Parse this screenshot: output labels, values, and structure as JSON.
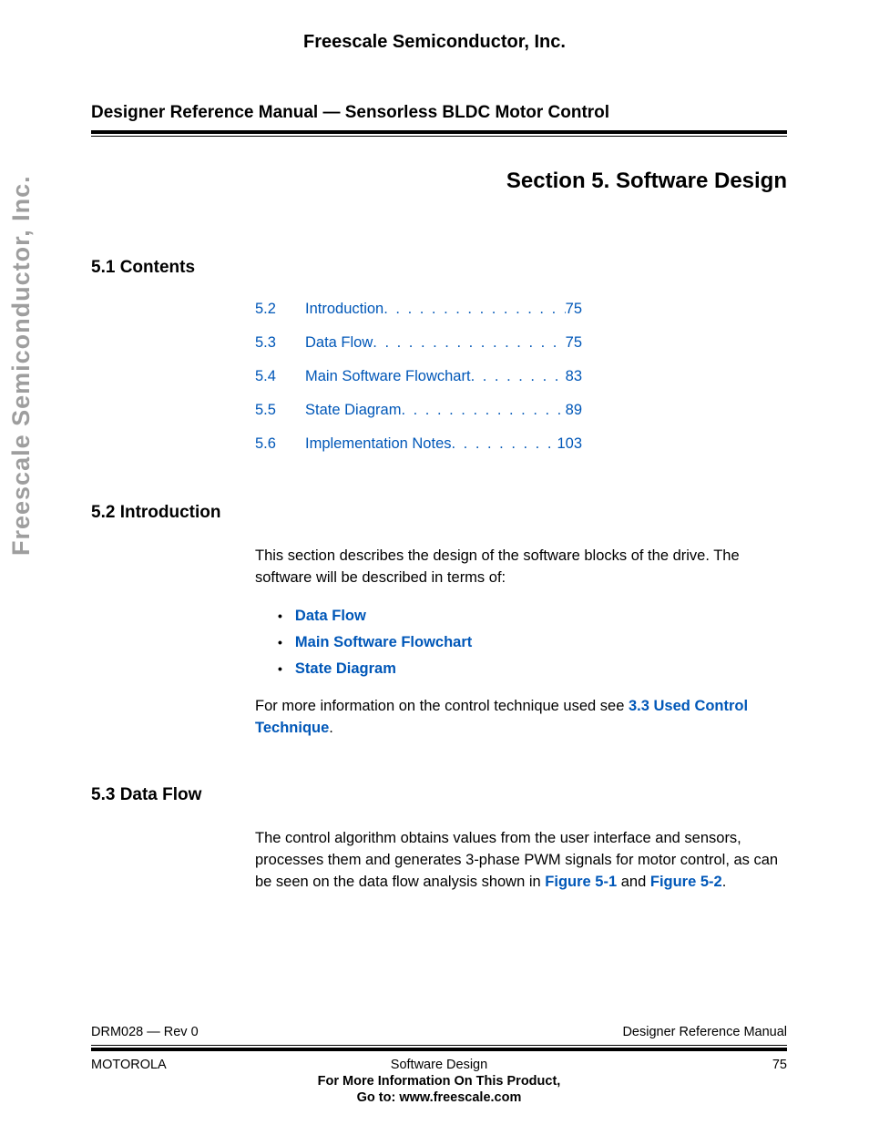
{
  "header": {
    "company": "Freescale Semiconductor, Inc."
  },
  "watermark": "Freescale Semiconductor, Inc.",
  "subtitle": "Designer Reference Manual — Sensorless BLDC Motor Control",
  "section_title": "Section 5. Software Design",
  "headings": {
    "contents": "5.1  Contents",
    "introduction": "5.2  Introduction",
    "dataflow": "5.3  Data Flow"
  },
  "toc": [
    {
      "num": "5.2",
      "title": "Introduction",
      "page": "75"
    },
    {
      "num": "5.3",
      "title": "Data Flow ",
      "page": "75"
    },
    {
      "num": "5.4",
      "title": "Main Software Flowchart ",
      "page": "83"
    },
    {
      "num": "5.5",
      "title": "State Diagram",
      "page": "89"
    },
    {
      "num": "5.6",
      "title": "Implementation Notes",
      "page": "103"
    }
  ],
  "intro": {
    "para1": "This section describes the design of the software blocks of the drive. The software will be described in terms of:",
    "bullets": [
      "Data Flow",
      "Main Software Flowchart",
      "State Diagram"
    ],
    "para2_pre": "For more information on the control technique used see ",
    "para2_link": "3.3 Used Control Technique",
    "para2_post": "."
  },
  "dataflow": {
    "para_pre": "The control algorithm obtains values from the user interface and sensors, processes them and generates 3-phase PWM signals for motor control, as can be seen on the data flow analysis shown in ",
    "link1": "Figure 5-1",
    "mid": " and ",
    "link2": "Figure 5-2",
    "post": "."
  },
  "footer": {
    "doc_id": "DRM028 — Rev 0",
    "manual": "Designer Reference Manual",
    "brand": "MOTOROLA",
    "section": "Software Design",
    "page_num": "75",
    "info_line1": "For More Information On This Product,",
    "info_line2": "Go to: www.freescale.com"
  }
}
